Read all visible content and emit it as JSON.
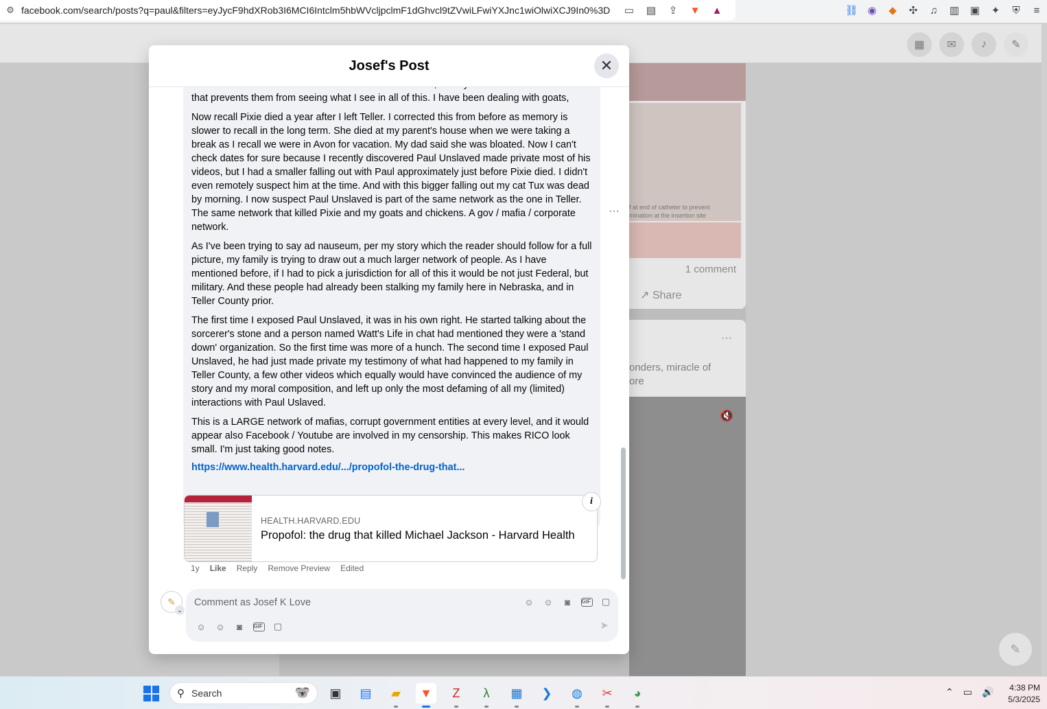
{
  "browser": {
    "url": "facebook.com/search/posts?q=paul&filters=eyJycF9hdXRob3I6MCI6Intclm5hbWVcljpclmF1dGhvcl9tZVwiLFwiYXJnc1wiOlwiXCJ9In0%3D"
  },
  "modal": {
    "title": "Josef's Post",
    "paragraphs": [
      "most common causes of death for normal circumstance, as any doctor would. But I think that prevents them from seeing what I see in all of this. I have been dealing with goats, cats, chickens all being murdered for many years now. There is a pattern.",
      "Now recall Pixie died a year after I left Teller. I corrected this from before as memory is slower to recall in the long term. She died at my parent's house when we were taking a break as I recall we were in Avon for vacation. My dad said she was bloated. Now I can't check dates for sure because I recently discovered Paul Unslaved made private most of his videos, but I had a smaller falling out with Paul approximately just before Pixie died. I didn't even remotely suspect him at the time. And with this bigger falling out my cat Tux was dead by morning. I now suspect Paul Unslaved is part of the same network as the one in Teller. The same network that killed Pixie and my goats and chickens. A gov / mafia / corporate network.",
      "As I've been trying to say ad nauseum, per my story which the reader should follow for a full picture, my family is trying to draw out a much larger network of people. As I have mentioned before, if I had to pick a jurisdiction for all of this it would be not just Federal, but military. And these people had already been stalking my family here in Nebraska, and in Teller County prior.",
      "The first time I exposed Paul Unslaved, it was in his own right. He started talking about the sorcerer's stone and a person named Watt's Life in chat had mentioned they were a 'stand down' organization. So the first time was more of a hunch. The second time I exposed Paul Unslaved, he had just made private my testimony of what had happened to my family in Teller County, a few other videos which equally would have convinced the audience of my story and my moral composition, and left up only the most defaming of all my (limited) interactions with Paul Uslaved.",
      "This is a LARGE network of mafias, corrupt government entities at every level, and it would appear also Facebook / Youtube are involved in my censorship. This makes RICO look small. I'm just taking good notes."
    ],
    "link_text": "https://www.health.harvard.edu/.../propofol-the-drug-that...",
    "preview": {
      "domain": "HEALTH.HARVARD.EDU",
      "title": "Propofol: the drug that killed Michael Jackson - Harvard Health",
      "info": "i"
    },
    "actions": {
      "time": "1y",
      "like": "Like",
      "reply": "Reply",
      "remove_preview": "Remove Preview",
      "edited": "Edited"
    },
    "more": "···",
    "close": "✕",
    "comment_placeholder": "Comment as Josef K Love"
  },
  "background": {
    "comment_count": "1 comment",
    "share": "Share",
    "snippet_line1": "onders, miracle of",
    "snippet_line2": "ore",
    "caption_line1": "f at end of catheter to prevent",
    "caption_line2": "mination at the insertion site"
  },
  "taskbar": {
    "search_label": "Search",
    "time": "4:38 PM",
    "date": "5/3/2025"
  },
  "colors": {
    "link": "#0064d1",
    "bubble": "#f0f2f5",
    "brave": "#fb542b",
    "accent": "#1a73e8"
  }
}
